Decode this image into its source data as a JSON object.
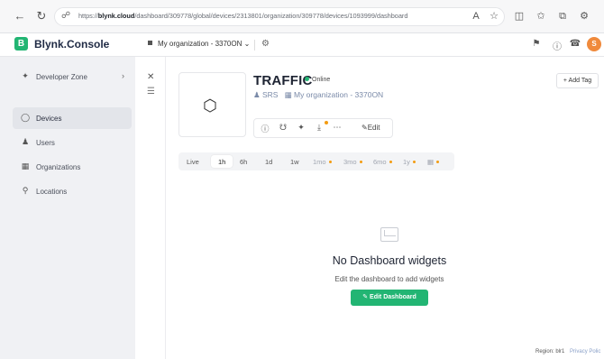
{
  "browser": {
    "url_prefix": "https://",
    "url_host": "blynk.cloud",
    "url_path": "/dashboard/309778/global/devices/2313801/organization/309778/devices/1093999/dashboard"
  },
  "app": {
    "logo_letter": "B",
    "logo_text": "Blynk.Console",
    "org_name": "My organization - 3370ON",
    "avatar_initial": "S",
    "accent": "#22b573"
  },
  "sidebar": {
    "items": [
      {
        "label": "Developer Zone",
        "icon": "wrench-icon"
      },
      {
        "label": "Devices",
        "icon": "cube-icon"
      },
      {
        "label": "Users",
        "icon": "users-icon"
      },
      {
        "label": "Organizations",
        "icon": "building-icon"
      },
      {
        "label": "Locations",
        "icon": "pin-icon"
      }
    ]
  },
  "device": {
    "name": "TRAFFIC",
    "status": "Online",
    "owner": "SRS",
    "org": "My organization - 3370ON",
    "edit_label": "Edit",
    "add_tag_label": "Add Tag"
  },
  "time_ranges": [
    "Live",
    "1h",
    "6h",
    "1d",
    "1w",
    "1mo",
    "3mo",
    "6mo",
    "1y"
  ],
  "empty": {
    "title": "No Dashboard widgets",
    "subtitle": "Edit the dashboard to add widgets",
    "button": "Edit Dashboard"
  },
  "footer": {
    "region": "Region: blr1",
    "privacy": "Privacy Polic"
  }
}
